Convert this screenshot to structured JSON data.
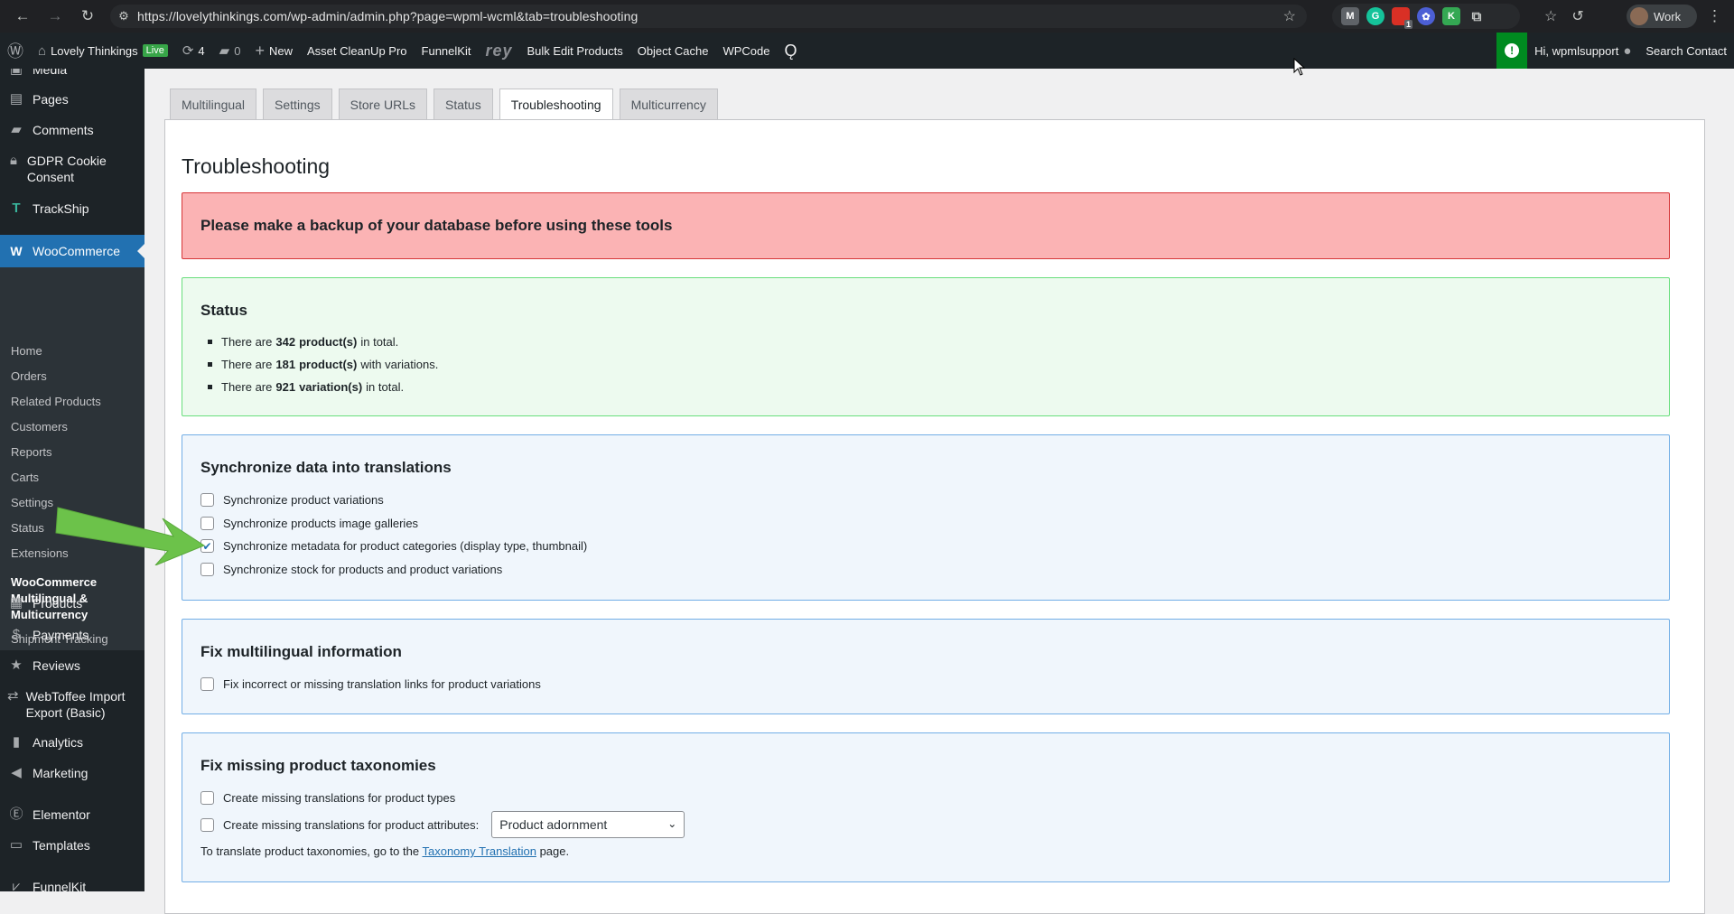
{
  "browser": {
    "url": "https://lovelythinkings.com/wp-admin/admin.php?page=wpml-wcml&tab=troubleshooting",
    "profile_label": "Work",
    "extension_badge": "1"
  },
  "adminbar": {
    "site_name": "Lovely Thinkings",
    "live_badge": "Live",
    "updates_count": "4",
    "comments_count": "0",
    "new_label": "New",
    "items": [
      "Asset CleanUp Pro",
      "FunnelKit",
      "rey",
      "Bulk Edit Products",
      "Object Cache",
      "WPCode"
    ],
    "greeting": "Hi, wpmlsupport",
    "search_label": "Search Contact"
  },
  "sidebar": {
    "top_items": [
      "Media",
      "Pages",
      "Comments",
      "GDPR Cookie Consent",
      "TrackShip"
    ],
    "active": "WooCommerce",
    "submenu": [
      "Home",
      "Orders",
      "Related Products",
      "Customers",
      "Reports",
      "Carts",
      "Settings",
      "Status",
      "Extensions"
    ],
    "current_sub": "WooCommerce Multilingual & Multicurrency",
    "after_current": "Shipment Tracking",
    "bottom_items": [
      "Products",
      "Payments",
      "Reviews",
      "WebToffee Import Export (Basic)",
      "Analytics",
      "Marketing",
      "Elementor",
      "Templates",
      "FunnelKit"
    ]
  },
  "tabs": [
    {
      "label": "Multilingual",
      "active": false
    },
    {
      "label": "Settings",
      "active": false
    },
    {
      "label": "Store URLs",
      "active": false
    },
    {
      "label": "Status",
      "active": false
    },
    {
      "label": "Troubleshooting",
      "active": true
    },
    {
      "label": "Multicurrency",
      "active": false
    }
  ],
  "page_title": "Troubleshooting",
  "alert": "Please make a backup of your database before using these tools",
  "status": {
    "title": "Status",
    "lines": [
      {
        "pre": "There are",
        "count": "342",
        "bold": "product(s)",
        "post": "in total."
      },
      {
        "pre": "There are",
        "count": "181",
        "bold": "product(s)",
        "post": "with variations."
      },
      {
        "pre": "There are",
        "count": "921",
        "bold": "variation(s)",
        "post": "in total."
      }
    ]
  },
  "sync": {
    "title": "Synchronize data into translations",
    "options": [
      {
        "label": "Synchronize product variations",
        "checked": false
      },
      {
        "label": "Synchronize products image galleries",
        "checked": false
      },
      {
        "label": "Synchronize metadata for product categories (display type, thumbnail)",
        "checked": true
      },
      {
        "label": "Synchronize stock for products and product variations",
        "checked": false
      }
    ]
  },
  "fix": {
    "title": "Fix multilingual information",
    "option": "Fix incorrect or missing translation links for product variations"
  },
  "taxonomies": {
    "title": "Fix missing product taxonomies",
    "option_types": "Create missing translations for product types",
    "option_attributes": "Create missing translations for product attributes:",
    "selected_attribute": "Product adornment",
    "note_pre": "To translate product taxonomies, go to the",
    "note_link": "Taxonomy Translation",
    "note_post": "page."
  },
  "colors": {
    "wp_blue": "#2271b1",
    "admin_dark": "#1d2327",
    "alert_bg": "#fbb3b4",
    "status_bg": "#edfaef",
    "info_bg": "#f0f6fc",
    "arrow_green": "#6cc24a"
  }
}
